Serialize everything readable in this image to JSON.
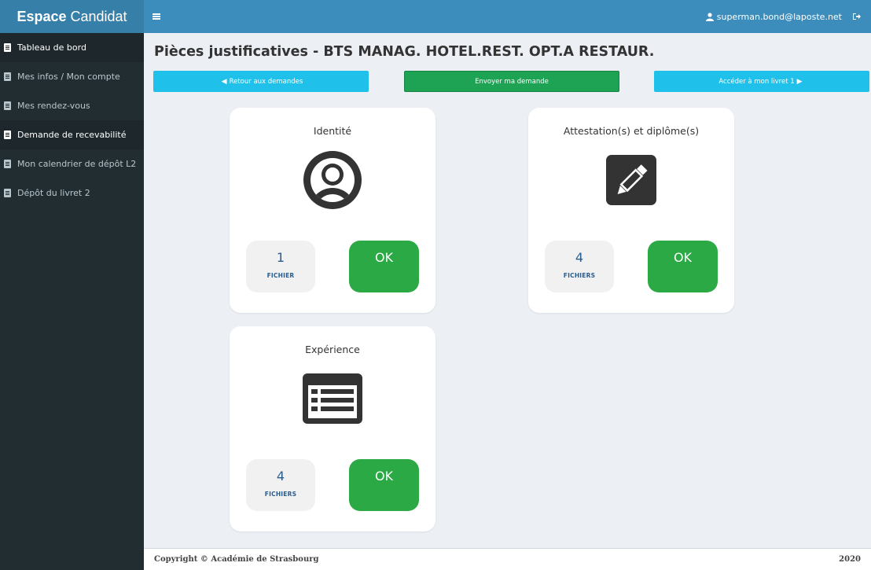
{
  "brand": {
    "bold": "Espace",
    "rest": "Candidat"
  },
  "sidebar": {
    "items": [
      {
        "label": "Tableau de bord",
        "active": true
      },
      {
        "label": "Mes infos / Mon compte",
        "active": false
      },
      {
        "label": "Mes rendez-vous",
        "active": false
      },
      {
        "label": "Demande de recevabilité",
        "active": true
      },
      {
        "label": "Mon calendrier de dépôt L2",
        "active": false
      },
      {
        "label": "Dépôt du livret 2",
        "active": false
      }
    ]
  },
  "topbar": {
    "user_email": "superman.bond@laposte.net"
  },
  "page": {
    "title": "Pièces justificatives - BTS MANAG. HOTEL.REST. OPT.A RESTAUR."
  },
  "actions": {
    "back": "Retour aux demandes",
    "send": "Envoyer ma demande",
    "next": "Accéder à mon livret 1"
  },
  "cards": [
    {
      "title": "Identité",
      "icon": "user-circle-icon",
      "count": "1",
      "count_label": "FICHIER",
      "status": "OK"
    },
    {
      "title": "Attestation(s) et diplôme(s)",
      "icon": "pencil-square-icon",
      "count": "4",
      "count_label": "FICHIERS",
      "status": "OK"
    },
    {
      "title": "Expérience",
      "icon": "list-alt-icon",
      "count": "4",
      "count_label": "FICHIERS",
      "status": "OK"
    }
  ],
  "footer": {
    "copyright": "Copyright © Académie de Strasbourg",
    "year": "2020"
  },
  "colors": {
    "sidebar_bg": "#222d32",
    "topbar_bg": "#3c8dbc",
    "brand_bg": "#367fa9",
    "info": "#1fc1ea",
    "success": "#1ea254",
    "ok": "#2ba945",
    "count_text": "#2a5d8f"
  }
}
